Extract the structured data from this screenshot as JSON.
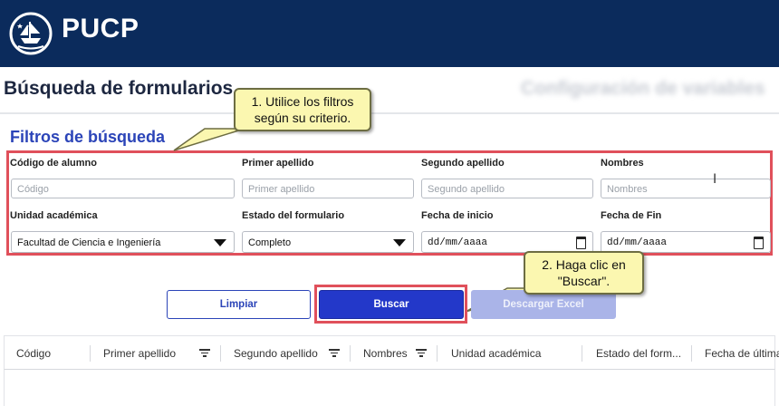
{
  "brand": {
    "name": "PUCP",
    "bar_color": "#0b2b5c"
  },
  "page": {
    "title": "Búsqueda de formularios",
    "blurred_heading": "Configuración de variables"
  },
  "filters": {
    "section_title": "Filtros de búsqueda",
    "codigo": {
      "label": "Código de alumno",
      "placeholder": "Código"
    },
    "primer_apellido": {
      "label": "Primer apellido",
      "placeholder": "Primer apellido"
    },
    "segundo_apellido": {
      "label": "Segundo apellido",
      "placeholder": "Segundo apellido"
    },
    "nombres": {
      "label": "Nombres",
      "placeholder": "Nombres"
    },
    "unidad": {
      "label": "Unidad académica",
      "value": "Facultad de Ciencia e Ingeniería"
    },
    "estado": {
      "label": "Estado del formulario",
      "value": "Completo"
    },
    "fecha_inicio": {
      "label": "Fecha de inicio",
      "value": "dd/mm/aaaa"
    },
    "fecha_fin": {
      "label": "Fecha de Fin",
      "value": "dd/mm/aaaa"
    }
  },
  "callouts": {
    "step1": [
      "1. Utilice los filtros",
      "según su criterio."
    ],
    "step2": [
      "2. Haga clic en",
      "\"Buscar\"."
    ]
  },
  "buttons": {
    "clear": "Limpiar",
    "search": "Buscar",
    "excel": "Descargar Excel"
  },
  "table": {
    "columns": [
      "Código",
      "Primer apellido",
      "Segundo apellido",
      "Nombres",
      "Unidad académica",
      "Estado del form...",
      "Fecha de última"
    ]
  },
  "colors": {
    "accent": "#2b44b8",
    "search_button": "#2338c9",
    "highlight": "#e0505b",
    "callout_bg": "#fbf7b0"
  }
}
